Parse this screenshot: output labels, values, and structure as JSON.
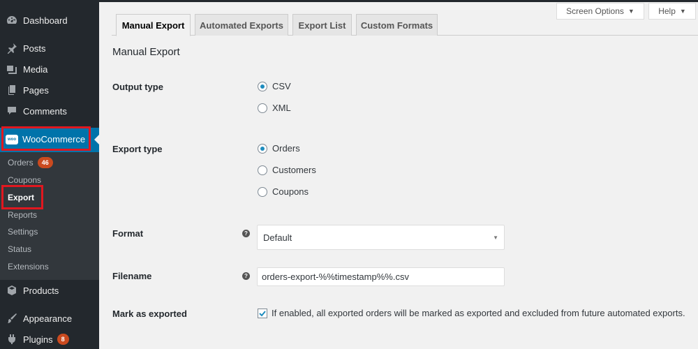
{
  "sidebar": {
    "items": [
      {
        "label": "Dashboard",
        "icon": "dashboard-icon"
      },
      {
        "label": "Posts",
        "icon": "pin-icon"
      },
      {
        "label": "Media",
        "icon": "media-icon"
      },
      {
        "label": "Pages",
        "icon": "pages-icon"
      },
      {
        "label": "Comments",
        "icon": "comments-icon"
      },
      {
        "label": "WooCommerce",
        "icon": "woocommerce-icon"
      },
      {
        "label": "Products",
        "icon": "products-icon"
      },
      {
        "label": "Appearance",
        "icon": "brush-icon"
      },
      {
        "label": "Plugins",
        "icon": "plugin-icon",
        "badge": "8"
      }
    ],
    "woo_logo_text": "woo",
    "submenu": [
      {
        "label": "Orders",
        "badge": "46"
      },
      {
        "label": "Coupons"
      },
      {
        "label": "Export"
      },
      {
        "label": "Reports"
      },
      {
        "label": "Settings"
      },
      {
        "label": "Status"
      },
      {
        "label": "Extensions"
      }
    ]
  },
  "header": {
    "screen_options": "Screen Options",
    "help": "Help"
  },
  "tabs": [
    {
      "label": "Manual Export",
      "active": true
    },
    {
      "label": "Automated Exports"
    },
    {
      "label": "Export List"
    },
    {
      "label": "Custom Formats"
    }
  ],
  "main": {
    "heading": "Manual Export",
    "output_type": {
      "label": "Output type",
      "options": [
        {
          "label": "CSV",
          "checked": true
        },
        {
          "label": "XML",
          "checked": false
        }
      ]
    },
    "export_type": {
      "label": "Export type",
      "options": [
        {
          "label": "Orders",
          "checked": true
        },
        {
          "label": "Customers",
          "checked": false
        },
        {
          "label": "Coupons",
          "checked": false
        }
      ]
    },
    "format": {
      "label": "Format",
      "value": "Default"
    },
    "filename": {
      "label": "Filename",
      "value": "orders-export-%%timestamp%%.csv"
    },
    "mark_exported": {
      "label": "Mark as exported",
      "checked": true,
      "text": "If enabled, all exported orders will be marked as exported and excluded from future automated exports."
    }
  },
  "colors": {
    "sidebar_bg": "#23282d",
    "accent": "#0073aa",
    "highlight_box": "#e1171f",
    "badge": "#ca4a1f"
  }
}
